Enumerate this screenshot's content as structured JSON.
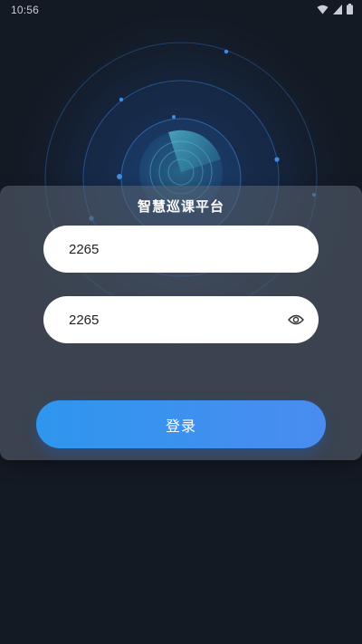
{
  "status_bar": {
    "time": "10:56"
  },
  "app": {
    "title": "智慧巡课平台"
  },
  "login_form": {
    "username_value": "2265",
    "password_value": "2265",
    "submit_label": "登录"
  },
  "icons": {
    "password_toggle": "eye-icon",
    "wifi": "wifi-icon",
    "signal": "signal-icon",
    "battery": "battery-icon"
  },
  "colors": {
    "background": "#141a24",
    "accent": "#2e96ee",
    "card": "#545e6c"
  }
}
